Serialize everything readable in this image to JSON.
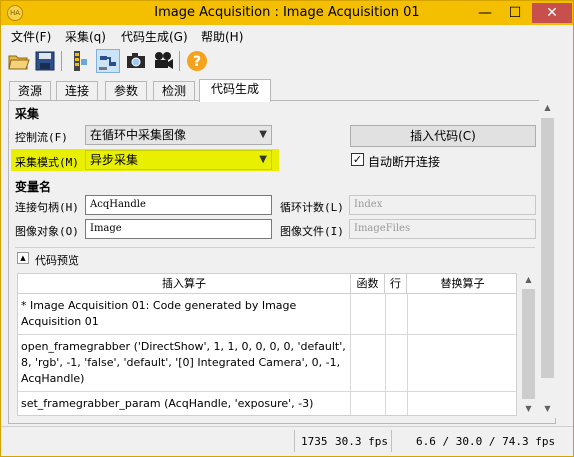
{
  "window": {
    "title": "Image Acquisition : Image Acquisition 01",
    "app_icon_text": "HA",
    "minimize": "—",
    "maximize": "☐",
    "close": "✕"
  },
  "menu": [
    "文件(F)",
    "采集(q)",
    "代码生成(G)",
    "帮助(H)"
  ],
  "toolbar": {
    "icons": [
      "open-folder-icon",
      "save-icon",
      "connect-icon",
      "detect-icon",
      "snap-icon",
      "live-video-icon",
      "help-icon"
    ],
    "help_glyph": "?"
  },
  "tabs": [
    "资源",
    "连接",
    "参数",
    "检测",
    "代码生成"
  ],
  "active_tab": "代码生成",
  "acquisition": {
    "section_title": "采集",
    "control_flow_label": "控制流(F)",
    "control_flow_value": "在循环中采集图像",
    "mode_label": "采集模式(M)",
    "mode_value": "异步采集",
    "insert_code_button": "插入代码(C)",
    "auto_disconnect_label": "自动断开连接",
    "auto_disconnect_checked": true
  },
  "variables": {
    "section_title": "变量名",
    "handle_label": "连接句柄(H)",
    "handle_value": "AcqHandle",
    "loop_counter_label": "循环计数(L)",
    "loop_counter_value": "Index",
    "image_object_label": "图像对象(O)",
    "image_object_value": "Image",
    "image_files_label": "图像文件(I)",
    "image_files_value": "ImageFiles"
  },
  "preview": {
    "title": "代码预览",
    "collapse_glyph": "▲",
    "columns": [
      "插入算子",
      "函数",
      "行",
      "替换算子"
    ],
    "rows": [
      {
        "op": "* Image Acquisition 01: Code generated by Image Acquisition 01"
      },
      {
        "op": "open_framegrabber ('DirectShow', 1, 1, 0, 0, 0, 0, 'default', 8, 'rgb', -1, 'false', 'default', '[0] Integrated Camera', 0, -1, AcqHandle)"
      },
      {
        "op": "set_framegrabber_param (AcqHandle, 'exposure', -3)"
      }
    ]
  },
  "status": {
    "frame_count": "1735",
    "fps": "30.3 fps",
    "timing": "6.6 / 30.0 / 74.3 fps"
  }
}
